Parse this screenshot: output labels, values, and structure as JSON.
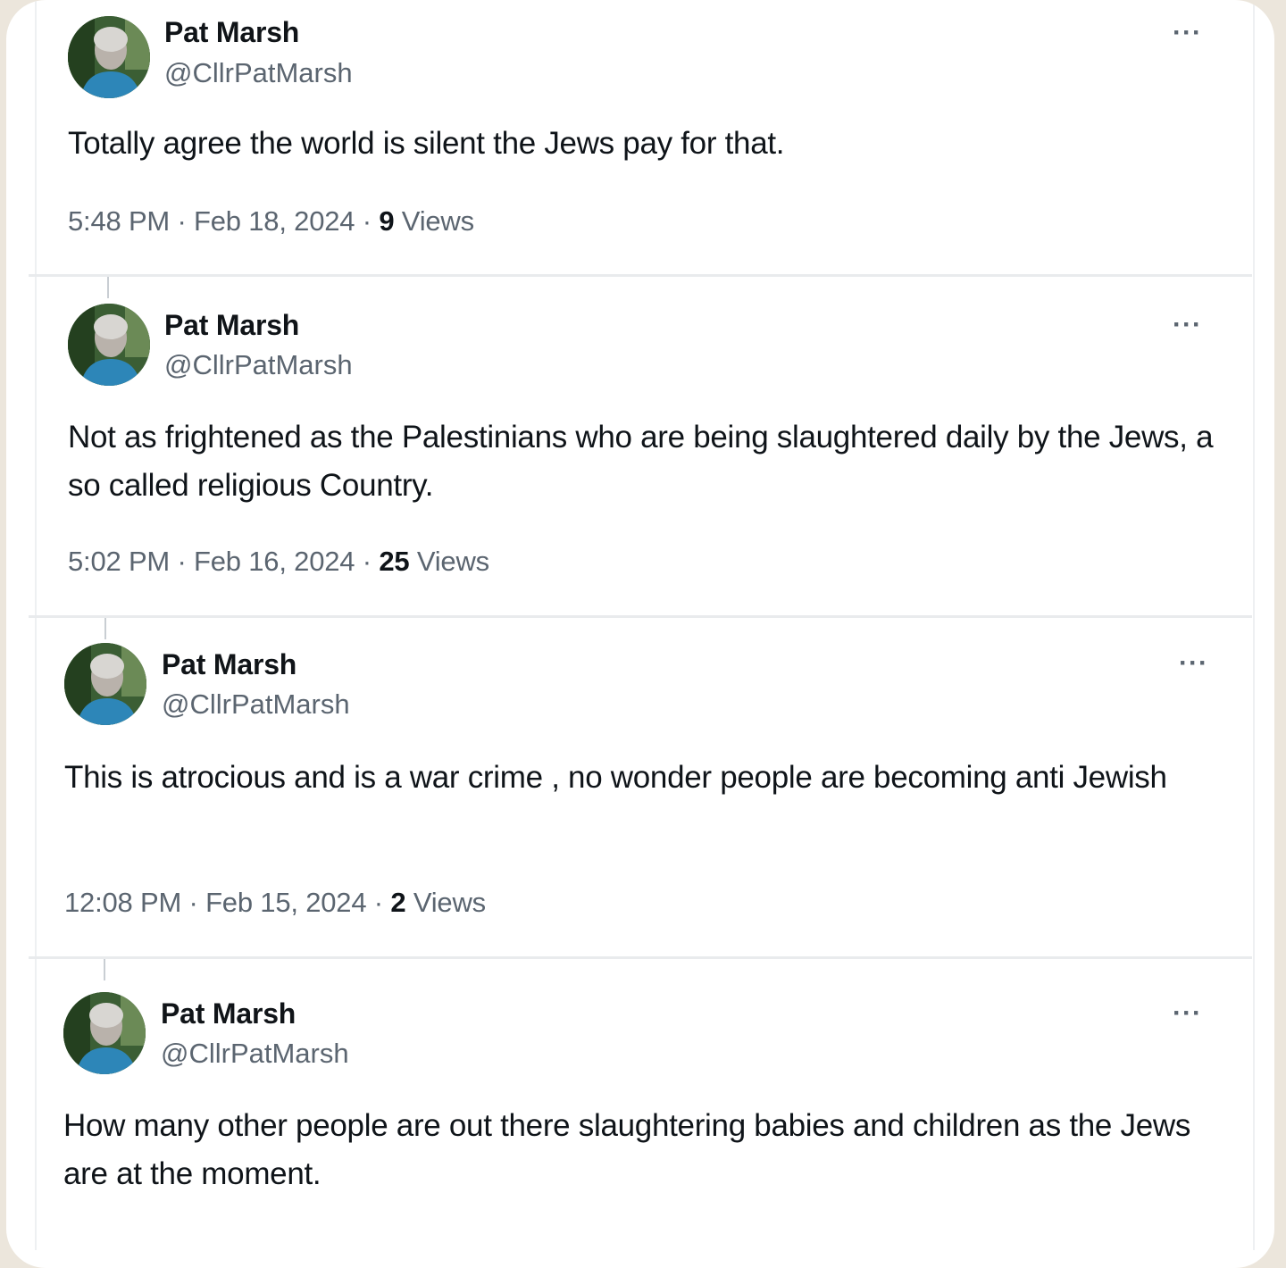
{
  "tweets": [
    {
      "name": "Pat Marsh",
      "handle": "@CllrPatMarsh",
      "more": "···",
      "text": "Totally agree the world is silent the Jews pay for that.",
      "time": "5:48 PM",
      "date": "Feb 18, 2024",
      "sep": "·",
      "views_count": "9",
      "views_label": "Views"
    },
    {
      "name": "Pat Marsh",
      "handle": "@CllrPatMarsh",
      "more": "···",
      "text": "Not as frightened as the Palestinians who are being slaughtered daily by the Jews, a so called religious Country.",
      "time": "5:02 PM",
      "date": "Feb 16, 2024",
      "sep": "·",
      "views_count": "25",
      "views_label": "Views"
    },
    {
      "name": "Pat Marsh",
      "handle": "@CllrPatMarsh",
      "more": "···",
      "text": "This is atrocious and is a war crime , no wonder people are becoming anti Jewish",
      "time": "12:08 PM",
      "date": "Feb 15, 2024",
      "sep": "·",
      "views_count": "2",
      "views_label": "Views"
    },
    {
      "name": "Pat Marsh",
      "handle": "@CllrPatMarsh",
      "more": "···",
      "text": "How many other people are out there slaughtering babies and children as the Jews are at the moment.",
      "time": "",
      "date": "",
      "sep": "",
      "views_count": "",
      "views_label": ""
    }
  ],
  "icons": {
    "more": "more-options-icon",
    "avatar": "profile-avatar"
  },
  "colors": {
    "text": "#0f1419",
    "secondary": "#5b6570",
    "divider": "#e9ebed",
    "background": "#ece6dc"
  }
}
